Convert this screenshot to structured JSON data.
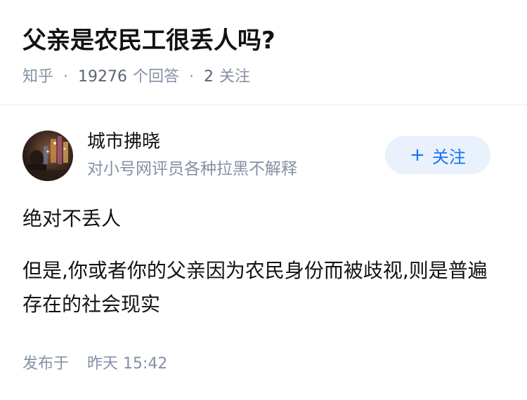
{
  "question": {
    "title": "父亲是农民工很丢人吗?",
    "source": "知乎",
    "answer_count": "19276",
    "answer_label": "个回答",
    "follower_count": "2",
    "follower_label": "关注",
    "separator": "·"
  },
  "answer": {
    "author": {
      "name": "城市拂晓",
      "headline": "对小号网评员各种拉黑不解释",
      "avatar_icon": "avatar-photo"
    },
    "follow_button": {
      "icon": "+",
      "label": "关注",
      "color": "#1772f6",
      "background": "#e8f1fc"
    },
    "paragraphs": [
      "绝对不丢人",
      "但是,你或者你的父亲因为农民身份而被歧视,则是普遍存在的社会现实"
    ],
    "published": {
      "label": "发布于",
      "time": "昨天 15:42"
    }
  }
}
